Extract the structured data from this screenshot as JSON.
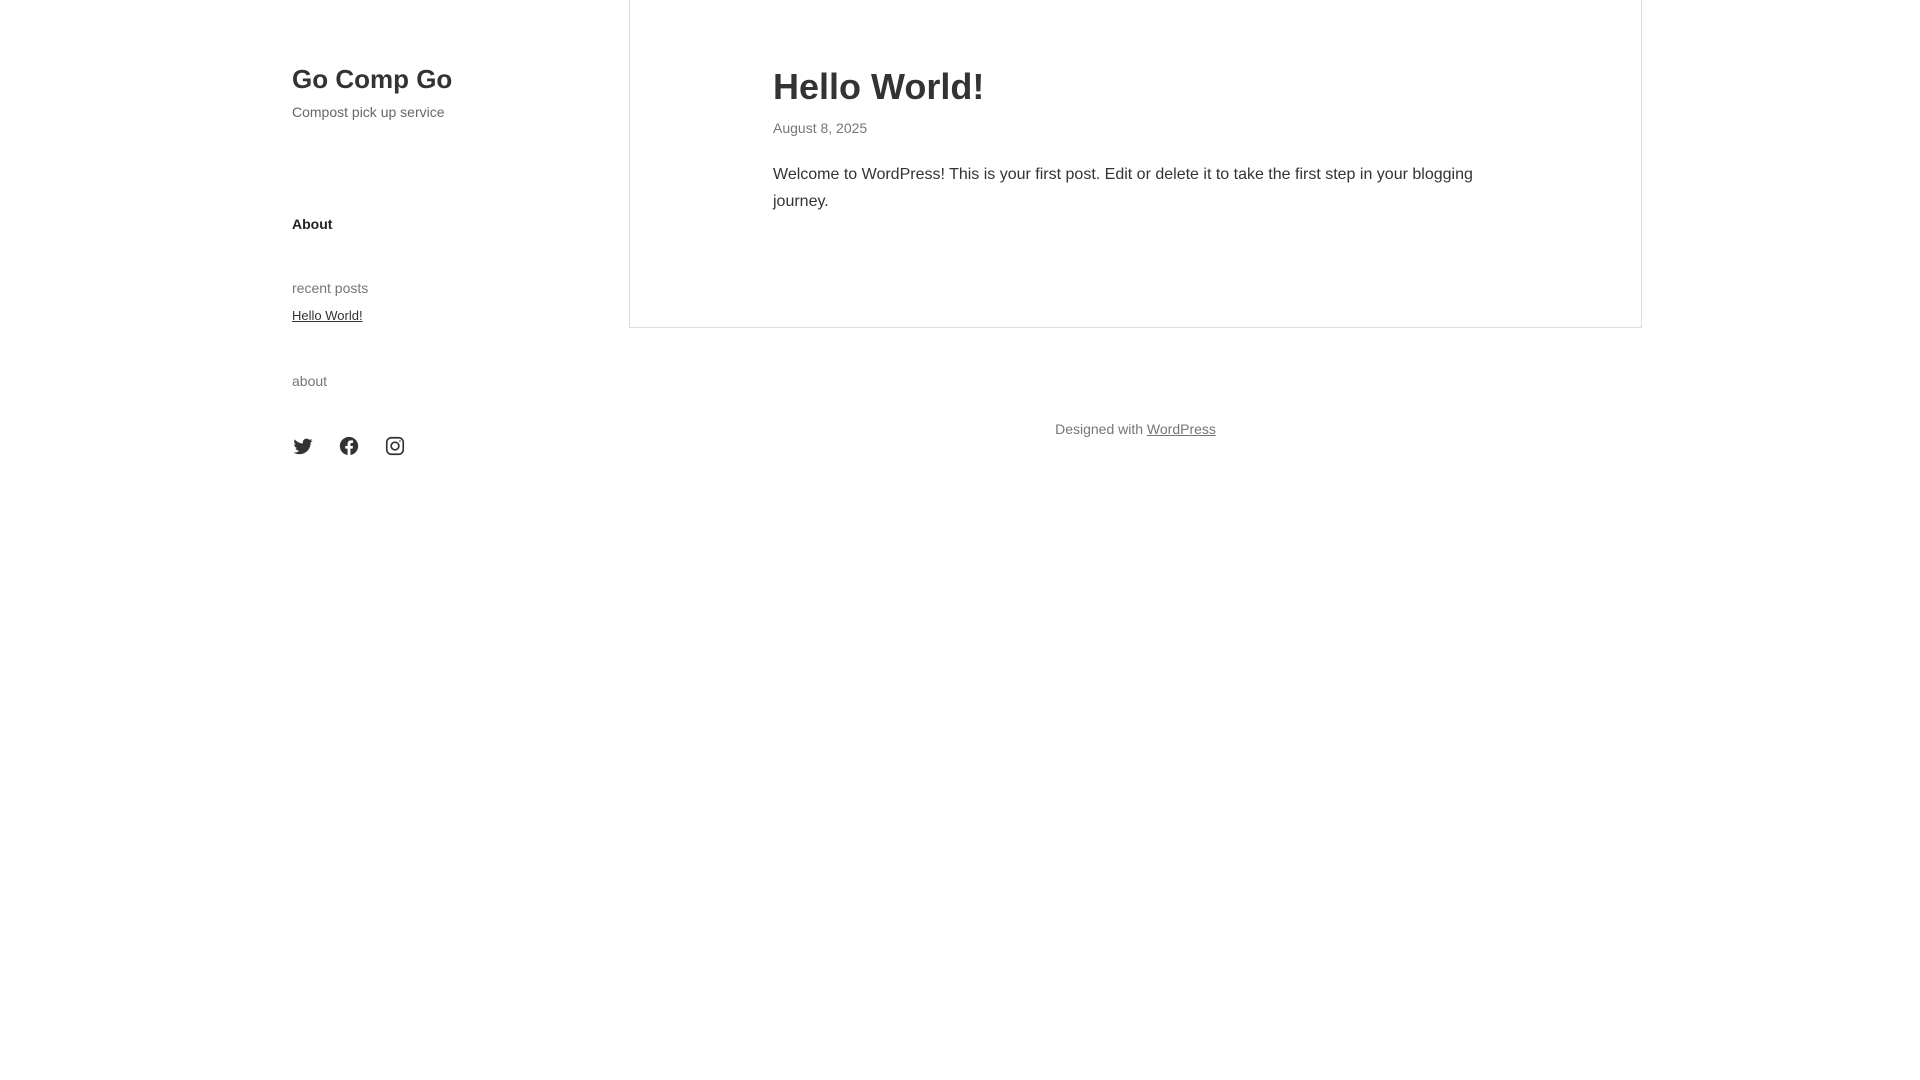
{
  "site": {
    "title": "Go Comp Go",
    "tagline": "Compost pick up service"
  },
  "sidebar": {
    "nav_about": "About",
    "recent_posts_title": "recent posts",
    "recent_posts": [
      {
        "label": "Hello World!"
      }
    ],
    "about_title": "about",
    "social": [
      {
        "icon": "twitter-icon"
      },
      {
        "icon": "facebook-icon"
      },
      {
        "icon": "instagram-icon"
      }
    ]
  },
  "post": {
    "title": "Hello World!",
    "date": "August 8, 2025",
    "body": "Welcome to WordPress! This is your first post. Edit or delete it to take the first step in your blogging journey."
  },
  "footer": {
    "prefix": "Designed with ",
    "link_label": "WordPress"
  },
  "colors": {
    "text": "#333333",
    "muted": "#767676",
    "border": "#dcdcdc",
    "background": "#ffffff"
  }
}
